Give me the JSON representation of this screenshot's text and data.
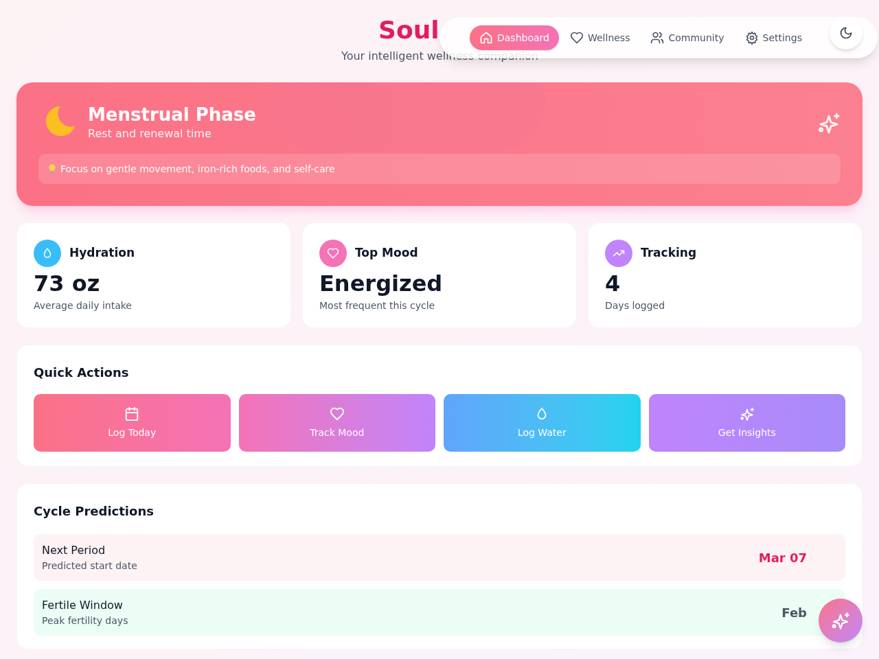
{
  "header": {
    "title": "Soul",
    "subtitle": "Your intelligent wellness companion"
  },
  "nav": [
    {
      "label": "Dashboard",
      "selected": true
    },
    {
      "label": "Wellness",
      "selected": false
    },
    {
      "label": "Community",
      "selected": false
    },
    {
      "label": "Settings",
      "selected": false
    }
  ],
  "phase": {
    "title": "Menstrual Phase",
    "subtitle": "Rest and renewal time",
    "tip": "Focus on gentle movement, iron-rich foods, and self-care"
  },
  "stats": [
    {
      "label": "Hydration",
      "color": "#38bdf8",
      "value": "73 oz",
      "caption": "Average daily intake"
    },
    {
      "label": "Top Mood",
      "color": "#f472b6",
      "value": "Energized",
      "caption": "Most frequent this cycle"
    },
    {
      "label": "Tracking",
      "color": "#c084fc",
      "value": "4",
      "caption": "Days logged"
    }
  ],
  "quick_actions": {
    "title": "Quick Actions",
    "items": [
      {
        "label": "Log Today",
        "kind": "pink"
      },
      {
        "label": "Track Mood",
        "kind": "magenta"
      },
      {
        "label": "Log Water",
        "kind": "blue"
      },
      {
        "label": "Get Insights",
        "kind": "purple"
      }
    ]
  },
  "predictions": {
    "title": "Cycle Predictions",
    "items": [
      {
        "title": "Next Period",
        "caption": "Predicted start date",
        "date": "Mar 07",
        "kind": "period"
      },
      {
        "title": "Fertile Window",
        "caption": "Peak fertility days",
        "date": "Feb",
        "kind": "fertile"
      }
    ]
  }
}
